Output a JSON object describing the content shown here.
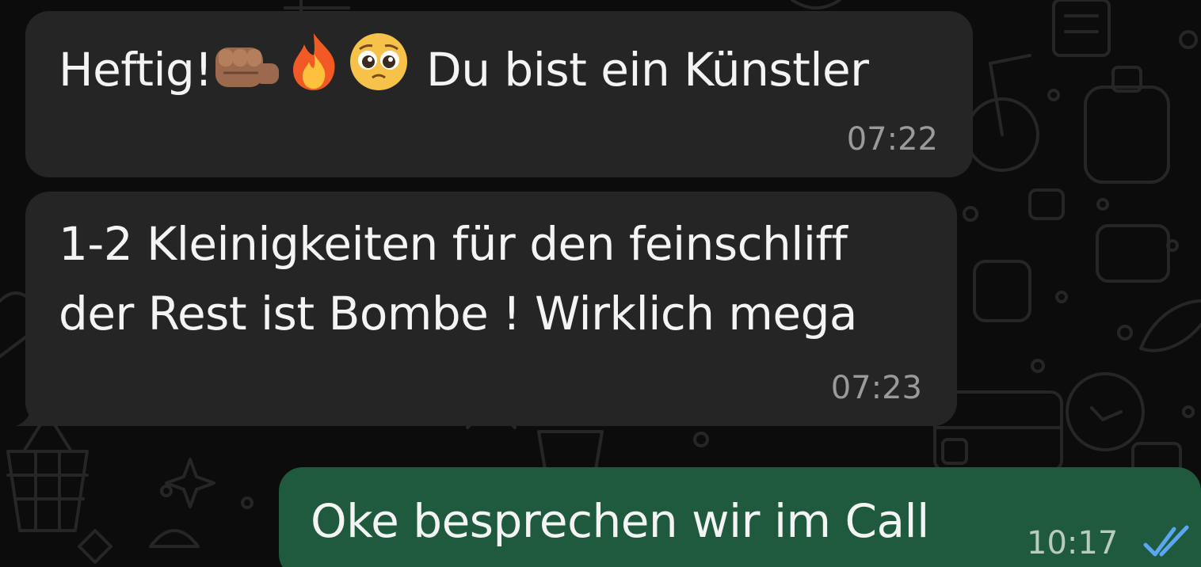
{
  "messages": [
    {
      "direction": "incoming",
      "text_before_emoji": "Heftig!",
      "emojis": [
        "fist-icon",
        "fire-icon",
        "pleading-face-icon"
      ],
      "text_after_emoji": " Du bist ein Künstler",
      "time": "07:22"
    },
    {
      "direction": "incoming",
      "lines": [
        "1-2 Kleinigkeiten für den feinschliff",
        "der Rest ist Bombe ! Wirklich mega"
      ],
      "time": "07:23"
    },
    {
      "direction": "outgoing",
      "text": "Oke besprechen wir im Call",
      "time": "10:17",
      "status": "read",
      "status_icon": "double-check-icon"
    }
  ],
  "colors": {
    "background": "#0c0c0c",
    "incoming_bubble": "#252525",
    "outgoing_bubble": "#1f5a3e",
    "read_ticks": "#5aa6f0"
  }
}
